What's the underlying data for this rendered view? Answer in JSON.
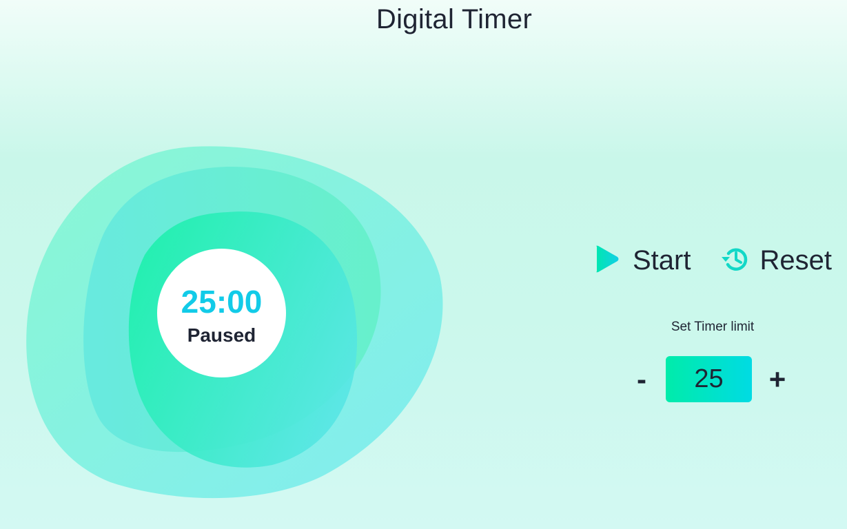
{
  "header": {
    "title": "Digital Timer"
  },
  "timer": {
    "display": "25:00",
    "status": "Paused"
  },
  "controls": {
    "start_label": "Start",
    "start_icon": "play-icon",
    "reset_label": "Reset",
    "reset_icon": "reset-history-icon"
  },
  "limit": {
    "label": "Set Timer limit",
    "decrement": "-",
    "value": "25",
    "increment": "+"
  },
  "colors": {
    "accent_cyan": "#12cbe8",
    "accent_green": "#00ecaa",
    "text_dark": "#1f2433"
  }
}
